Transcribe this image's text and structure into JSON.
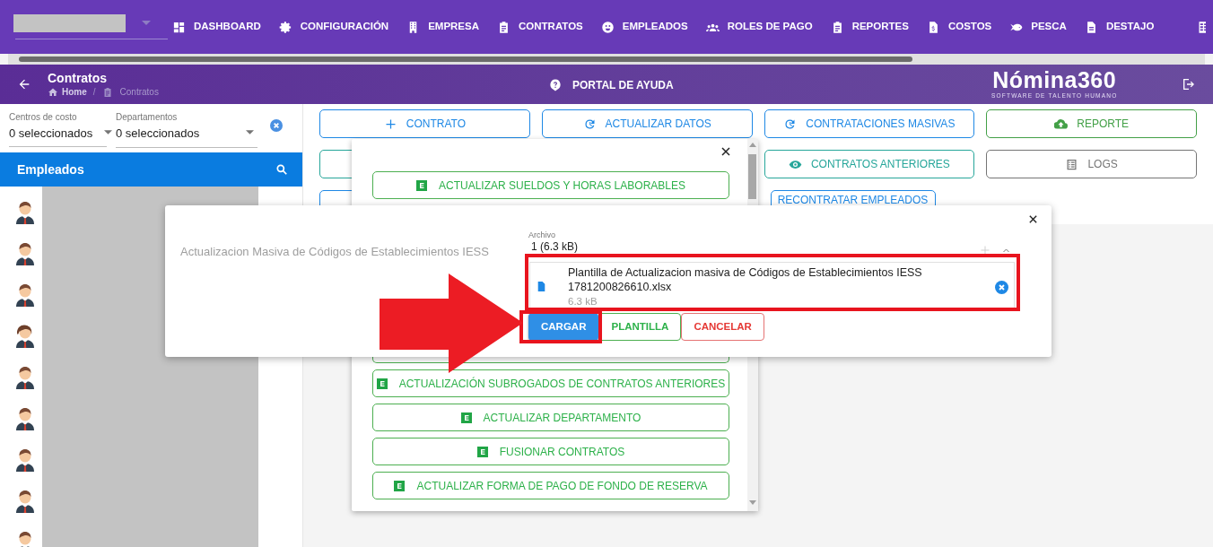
{
  "nav": {
    "items": [
      {
        "label": "DASHBOARD"
      },
      {
        "label": "CONFIGURACIÓN"
      },
      {
        "label": "EMPRESA"
      },
      {
        "label": "CONTRATOS"
      },
      {
        "label": "EMPLEADOS"
      },
      {
        "label": "ROLES DE PAGO"
      },
      {
        "label": "REPORTES"
      },
      {
        "label": "COSTOS"
      },
      {
        "label": "PESCA"
      },
      {
        "label": "DESTAJO"
      }
    ]
  },
  "header": {
    "title": "Contratos",
    "breadcrumb": [
      "Home",
      "Contratos"
    ],
    "breadcrumb_separator": "/",
    "help": "PORTAL DE AYUDA",
    "logo": "Nómina360",
    "logo_tagline": "SOFTWARE DE TALENTO HUMANO"
  },
  "filters": [
    {
      "label": "Centros de costo",
      "value": "0 seleccionados"
    },
    {
      "label": "Departamentos",
      "value": "0 seleccionados"
    }
  ],
  "employees": {
    "title": "Empleados",
    "avatars": [
      {
        "kind": "male"
      },
      {
        "kind": "male"
      },
      {
        "kind": "male"
      },
      {
        "kind": "female"
      },
      {
        "kind": "male"
      },
      {
        "kind": "male"
      },
      {
        "kind": "male"
      },
      {
        "kind": "male"
      },
      {
        "kind": "male"
      }
    ]
  },
  "actions": [
    {
      "label": "CONTRATO",
      "color": "#1e88e5"
    },
    {
      "label": "ACTUALIZAR DATOS",
      "color": "#1e88e5"
    },
    {
      "label": "CONTRATACIONES MASIVAS",
      "color": "#1e88e5"
    },
    {
      "label": "REPORTE",
      "color": "#43a047"
    },
    {
      "color": "#26a69a"
    },
    {
      "label": "CONTRATOS ANTERIORES",
      "color": "#26a69a"
    },
    {
      "label": "LOGS",
      "color": "#757575"
    },
    {
      "color": "#1e88e5"
    },
    {
      "label": "RECONTRATAR EMPLEADOS",
      "color": "#1e88e5"
    }
  ],
  "popup": {
    "items": [
      {
        "label": "ACTUALIZAR SUELDOS Y HORAS LABORABLES"
      },
      {
        "kind": "covered"
      },
      {
        "label": "ACTUALIZACIÓN SUBROGADOS DE CONTRATOS ANTERIORES"
      },
      {
        "label": "ACTUALIZAR DEPARTAMENTO"
      },
      {
        "label": "FUSIONAR CONTRATOS"
      },
      {
        "label": "ACTUALIZAR FORMA DE PAGO DE FONDO DE RESERVA"
      }
    ]
  },
  "modal": {
    "title": "Actualizacion Masiva de Códigos de Establecimientos IESS",
    "field_label": "Archivo",
    "count": "1 (6.3 kB)",
    "file_name": "Plantilla de Actualizacion masiva de Códigos de Establecimientos IESS 1781200826610.xlsx",
    "file_size": "6.3 kB",
    "buttons": [
      {
        "label": "CARGAR",
        "kind": "primary"
      },
      {
        "label": "PLANTILLA",
        "kind": "success"
      },
      {
        "label": "CANCELAR",
        "kind": "danger"
      }
    ]
  }
}
